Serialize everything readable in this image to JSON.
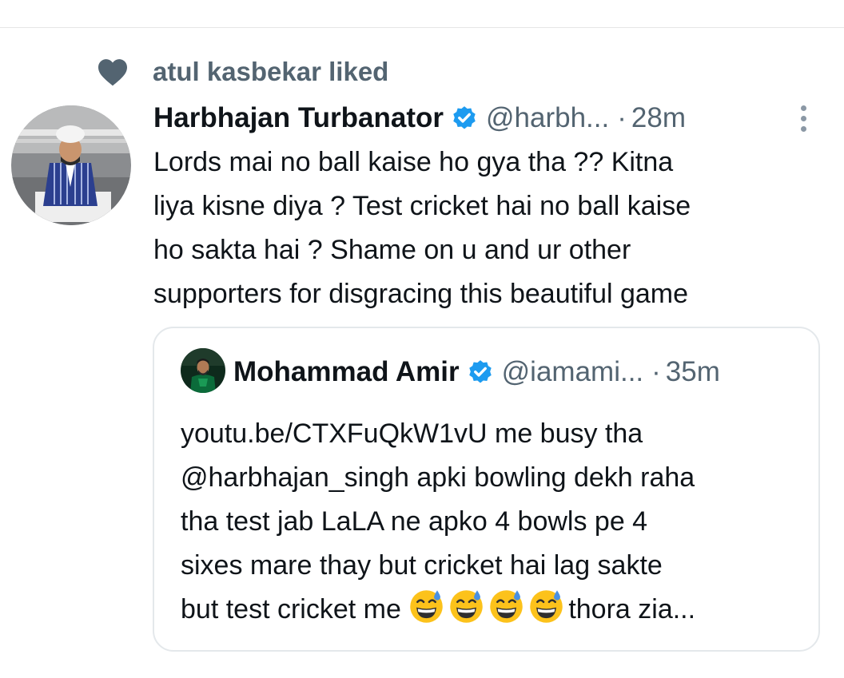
{
  "social_context": {
    "label": "atul kasbekar liked"
  },
  "tweet": {
    "author_name": "Harbhajan Turbanator",
    "author_handle": "@harbh...",
    "separator": "·",
    "time": "28m",
    "text_lines": [
      "Lords mai no ball kaise ho gya tha ?? Kitna",
      "liya kisne diya ? Test cricket hai no ball kaise",
      "ho sakta hai ? Shame on u and ur other",
      "supporters for disgracing this beautiful game"
    ]
  },
  "quoted_tweet": {
    "author_name": "Mohammad Amir",
    "author_handle": "@iamami...",
    "separator": "·",
    "time": "35m",
    "text_lines": [
      "youtu.be/CTXFuQkW1vU me busy tha",
      "@harbhajan_singh apki bowling dekh raha",
      "tha test jab LaLA ne apko 4 bowls pe 4",
      "sixes mare thay but cricket  hai lag sakte",
      "but test cricket me "
    ],
    "last_line_tail": "thora zia...",
    "emoji": [
      "grinning-face-with-sweat",
      "grinning-face-with-sweat",
      "grinning-face-with-sweat",
      "grinning-face-with-sweat"
    ]
  },
  "icons": {
    "heart": "heart-icon",
    "verified": "verified-badge-icon",
    "more": "more-options-icon"
  },
  "colors": {
    "text_primary": "#0f1419",
    "text_secondary": "#536471",
    "verified_blue": "#1d9bf0",
    "border": "#e4e8eb",
    "heart_fill": "#536471"
  }
}
